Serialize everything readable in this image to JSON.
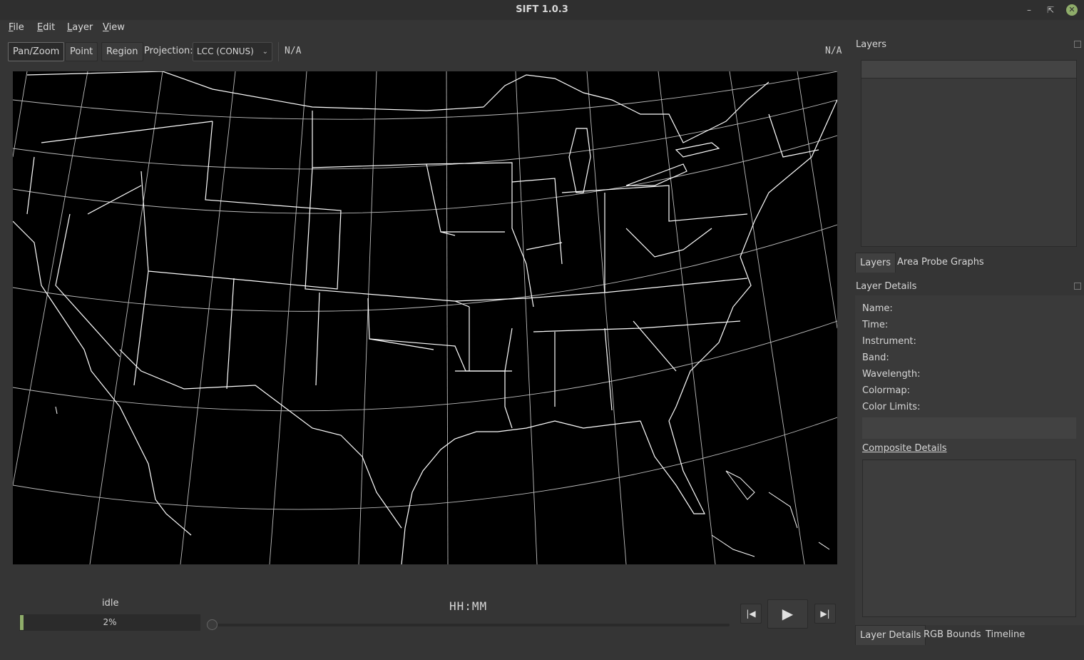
{
  "app": {
    "title": "SIFT 1.0.3"
  },
  "menu": [
    {
      "label": "File",
      "mnemonic": "F",
      "rest": "ile"
    },
    {
      "label": "Edit",
      "mnemonic": "E",
      "rest": "dit"
    },
    {
      "label": "Layer",
      "mnemonic": "L",
      "rest": "ayer"
    },
    {
      "label": "View",
      "mnemonic": "V",
      "rest": "iew"
    }
  ],
  "toolbar": {
    "pan_zoom": "Pan/Zoom",
    "point": "Point",
    "region": "Region",
    "projection_label": "Projection:",
    "projection_value": "LCC (CONUS)",
    "cursor_value_left": "N/A",
    "cursor_value_right": "N/A"
  },
  "map": {
    "description": "CONUS coastline and state borders with lat/lon grid",
    "background": "#000000",
    "line_color": "#ffffff"
  },
  "bottom": {
    "status": "idle",
    "progress_percent": 2,
    "progress_text": "2%",
    "clock": "HH:MM",
    "animation_position": 0
  },
  "layers_panel": {
    "title": "Layers",
    "tabs": [
      "Layers",
      "Area Probe Graphs"
    ]
  },
  "details_panel": {
    "title": "Layer Details",
    "fields": [
      "Name:",
      "Time:",
      "Instrument:",
      "Band:",
      "Wavelength:",
      "Colormap:",
      "Color Limits:"
    ],
    "composite_link": "Composite Details",
    "tabs": [
      "Layer Details",
      "RGB Bounds",
      "Timeline"
    ]
  },
  "colors": {
    "accent": "#8fad6a",
    "window_bg": "#353535",
    "panel_bg": "#3d3d3d"
  }
}
